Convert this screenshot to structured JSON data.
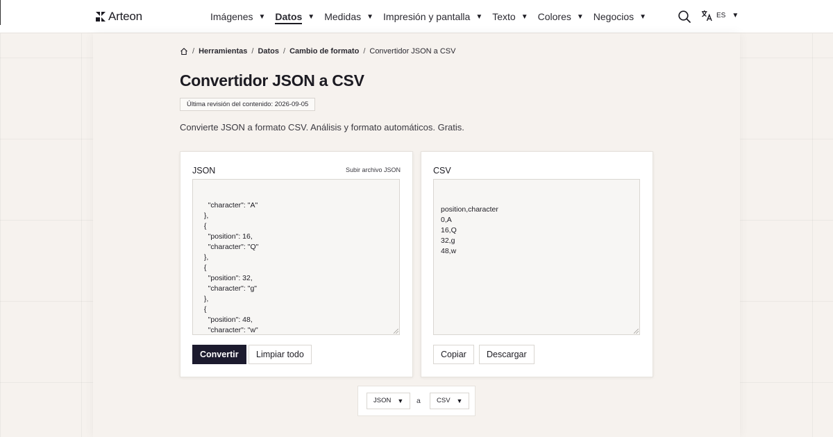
{
  "app": {
    "logo_text": "Arteon"
  },
  "nav": {
    "items": [
      {
        "label": "Imágenes"
      },
      {
        "label": "Datos",
        "active": true
      },
      {
        "label": "Medidas"
      },
      {
        "label": "Impresión y pantalla"
      },
      {
        "label": "Texto"
      },
      {
        "label": "Colores"
      },
      {
        "label": "Negocios"
      }
    ],
    "caret": "▼"
  },
  "language": {
    "code": "ES"
  },
  "breadcrumb": {
    "items": [
      "Herramientas",
      "Datos",
      "Cambio de formato"
    ],
    "current": "Convertidor JSON a CSV",
    "separator": "/"
  },
  "page": {
    "title": "Convertidor JSON a CSV",
    "review": "Última revisión del contenido: 2026-09-05",
    "description": "Convierte JSON a formato CSV. Análisis y formato automáticos. Gratis."
  },
  "json_panel": {
    "label": "JSON",
    "upload_label": "Subir archivo JSON",
    "text": "    \"character\": \"A\"\n  },\n  {\n    \"position\": 16,\n    \"character\": \"Q\"\n  },\n  {\n    \"position\": 32,\n    \"character\": \"g\"\n  },\n  {\n    \"position\": 48,\n    \"character\": \"w\"\n  }\n]",
    "convert_label": "Convertir",
    "clear_label": "Limpiar todo"
  },
  "csv_panel": {
    "label": "CSV",
    "text": "position,character\n0,A\n16,Q\n32,g\n48,w",
    "copy_label": "Copiar",
    "download_label": "Descargar"
  },
  "format": {
    "from": "JSON",
    "separator": "a",
    "to": "CSV"
  },
  "colors": {
    "background": "#f6f2ee",
    "primary_button": "#1c1b2e",
    "text": "#1c1b22"
  }
}
